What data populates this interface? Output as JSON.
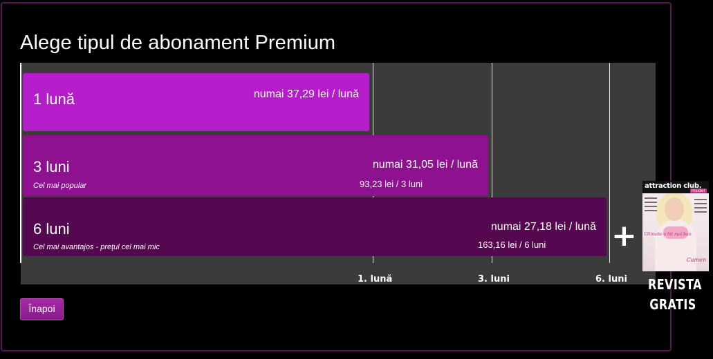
{
  "page": {
    "title": "Alege tipul de abonament Premium"
  },
  "plans": [
    {
      "period": "1 lună",
      "price": "numai 37,29 lei / lună",
      "subtitle": "",
      "total": ""
    },
    {
      "period": "3 luni",
      "price": "numai 31,05 lei / lună",
      "subtitle": "Cel mai popular",
      "total": "93,23 lei / 3 luni"
    },
    {
      "period": "6 luni",
      "price": "numai 27,18 lei / lună",
      "subtitle": "Cel mai avantajos - preţul cel mai mic",
      "total": "163,16 lei / 6 luni"
    }
  ],
  "ticks": [
    "1. lună",
    "3. luni",
    "6. luni"
  ],
  "bonus": {
    "plus": "+",
    "magazine_name": "attraction club.",
    "magazine_sub": "Insider",
    "cover_line": "Ultimate o bit mai bun",
    "cover_name": "Camen",
    "free_line1": "REVISTA",
    "free_line2": "GRATIS"
  },
  "back_button": "Înapoi",
  "colors": {
    "plan_1": "#b41dc9",
    "plan_3": "#8e128f",
    "plan_6": "#55084f",
    "chart_background": "#3b3b3b",
    "frame_border": "#5a1a5a"
  },
  "icons": [
    "plus-icon",
    "magazine-cover-image"
  ]
}
